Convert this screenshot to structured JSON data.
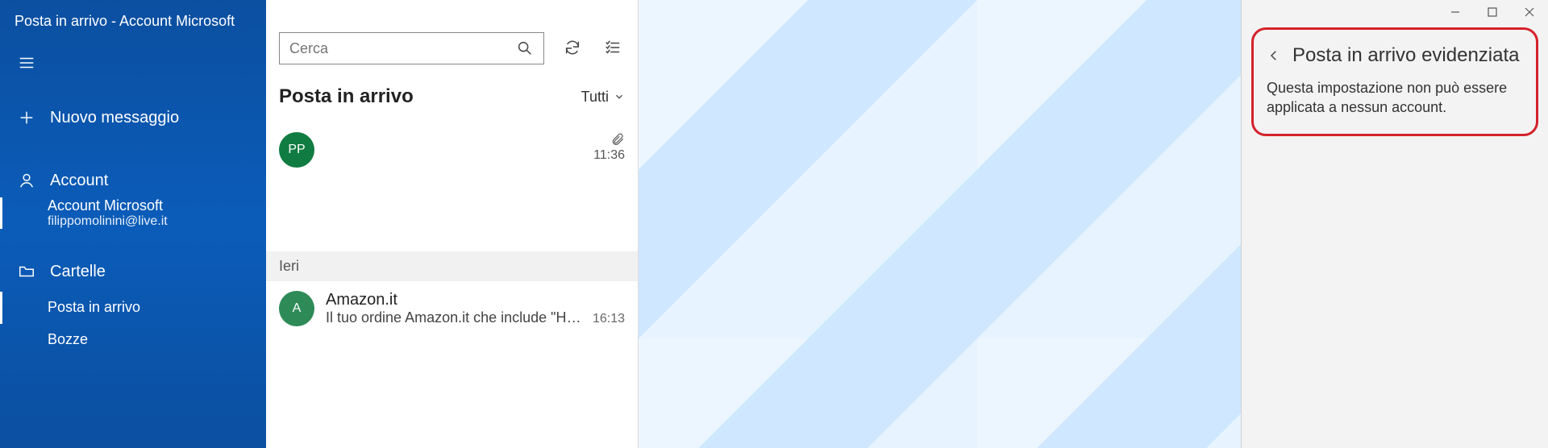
{
  "window": {
    "title": "Posta in arrivo - Account Microsoft"
  },
  "sidebar": {
    "new_message": "Nuovo messaggio",
    "accounts_label": "Account",
    "account": {
      "name": "Account Microsoft",
      "email": "filippomolinini@live.it"
    },
    "folders_label": "Cartelle",
    "folders": [
      {
        "label": "Posta in arrivo"
      },
      {
        "label": "Bozze"
      }
    ]
  },
  "list": {
    "search_placeholder": "Cerca",
    "header": "Posta in arrivo",
    "filter_label": "Tutti",
    "items": [
      {
        "avatar_initials": "PP",
        "avatar_color": "green",
        "sender": "",
        "preview": "",
        "time": "11:36",
        "has_attachment": true
      }
    ],
    "date_separator": "Ieri",
    "items_yesterday": [
      {
        "avatar_initials": "A",
        "avatar_color": "green2",
        "sender": "Amazon.it",
        "preview": "Il tuo ordine Amazon.it che include \"HP …",
        "time": "16:13",
        "has_attachment": false
      }
    ]
  },
  "settings": {
    "title": "Posta in arrivo evidenziata",
    "text": "Questa impostazione non può essere applicata a nessun account."
  }
}
